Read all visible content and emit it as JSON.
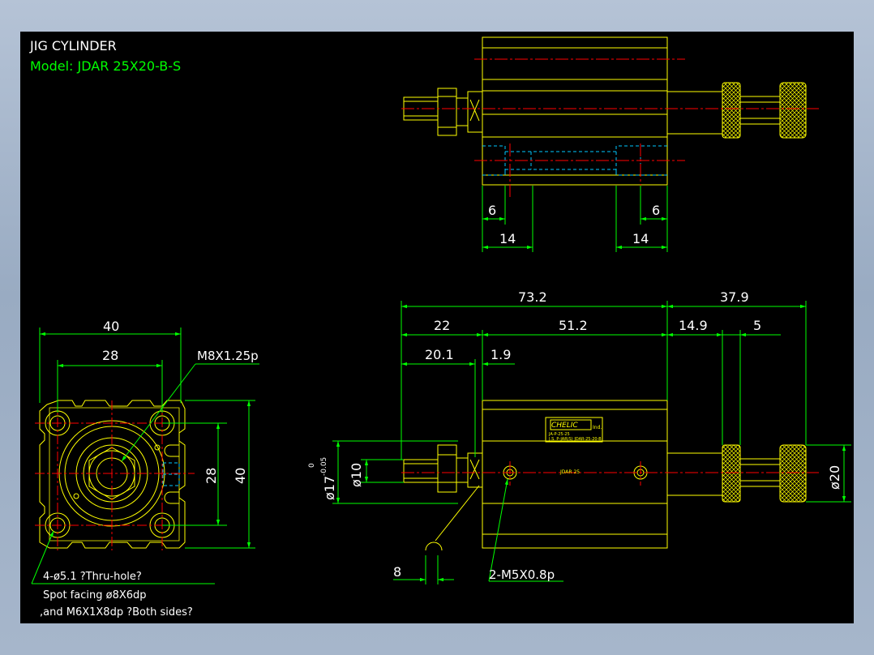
{
  "title_block": {
    "title": "JIG CYLINDER",
    "model": "Model:  JDAR 25X20-B-S"
  },
  "colors": {
    "background": "#000000",
    "outline": "#ffff00",
    "dimension": "#00ff00",
    "center_line": "#ff0000",
    "hidden_line": "#00c8ff",
    "text_white": "#ffffff",
    "window_bg": "#a9b8cc"
  },
  "top_view": {
    "dims": {
      "d6_left": "6",
      "d6_right": "6",
      "d14_left": "14",
      "d14_right": "14"
    }
  },
  "front_view": {
    "dims": {
      "d40_width": "40",
      "d28_width": "28",
      "d28_height": "28",
      "d40_height": "40",
      "thread_callout": "M8X1.25p"
    },
    "notes": {
      "holes": "4-ø5.1 ?Thru-hole?",
      "spot_facing": "Spot facing  ø8X6dp",
      "tap": ",and M6X1X8dp ?Both sides?"
    }
  },
  "side_view": {
    "dims": {
      "d73_2": "73.2",
      "d37_9": "37.9",
      "d22": "22",
      "d51_2": "51.2",
      "d14_9": "14.9",
      "d5": "5",
      "d20_1": "20.1",
      "d1_9": "1.9",
      "d8": "8",
      "dia17": "ø17",
      "dia17_tol_upper": "0",
      "dia17_tol_lower": "-0.05",
      "dia10": "ø10",
      "dia20": "ø20",
      "port_callout": "2-M5X0.8p"
    },
    "label_plate": {
      "brand": "CHELIC",
      "unit": "Ind.",
      "line1": "JA-P-25-25",
      "line2": "J.S. P-JAR(S) JDAR-25-20-B"
    },
    "body_text": "JDAR 25"
  }
}
